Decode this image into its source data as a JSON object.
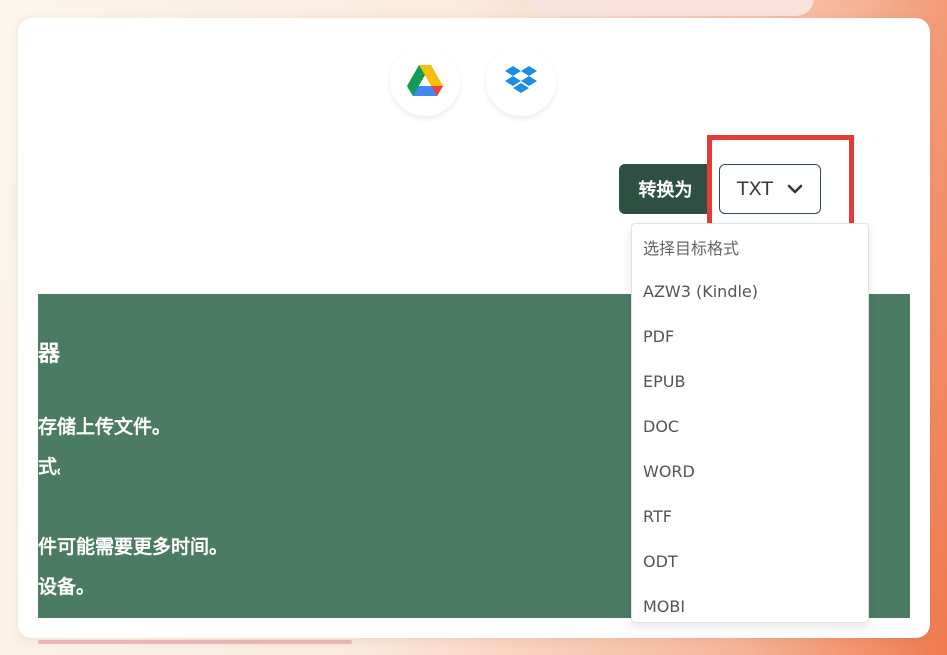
{
  "cloud": {
    "google_drive_icon": "google-drive-icon",
    "dropbox_icon": "dropbox-icon"
  },
  "converter": {
    "convert_to_label": "转换为",
    "selected_format": "TXT",
    "chevron_icon": "chevron-down-icon"
  },
  "dropdown": {
    "options": [
      "选择目标格式",
      "AZW3 (Kindle)",
      "PDF",
      "EPUB",
      "DOC",
      "WORD",
      "RTF",
      "ODT",
      "MOBI"
    ]
  },
  "panel": {
    "line1": "器",
    "line2": "存储上传文件。",
    "line3": "式。",
    "line4": "件可能需要更多时间。",
    "line5": "设备。"
  },
  "colors": {
    "accent_green": "#2e5042",
    "panel_green": "#4c7b64",
    "highlight_red": "#e63a3a"
  }
}
